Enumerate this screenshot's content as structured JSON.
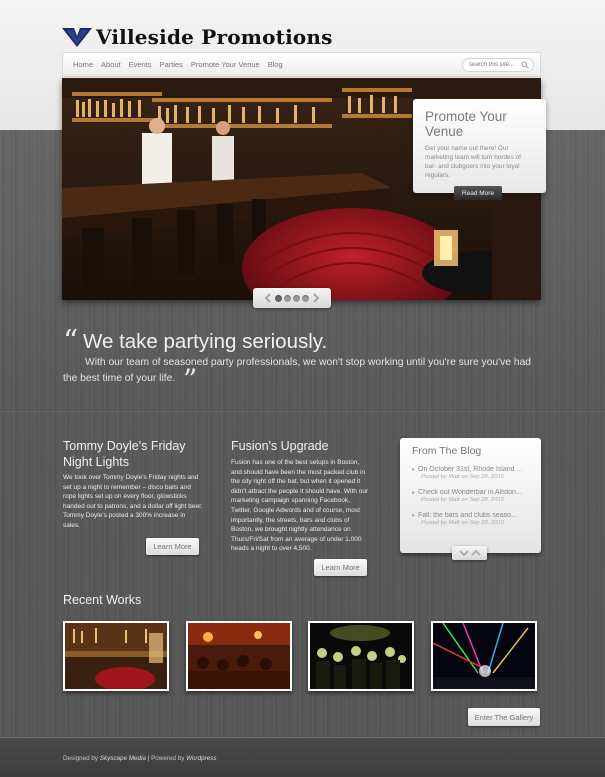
{
  "header": {
    "site_title": "Villeside Promotions",
    "nav": [
      "Home",
      "About",
      "Events",
      "Parties",
      "Promote Your Venue",
      "Blog"
    ],
    "search_placeholder": "search this site..."
  },
  "slider": {
    "promo_title": "Promote Your Venue",
    "promo_text": "Get your name out there! Our marketing team will turn hordes of bar- and clubgoers into your loyal regulars.",
    "promo_button": "Read More",
    "slide_count": 4,
    "active_slide": 1
  },
  "tagline": {
    "open_quote": "“",
    "heading": "We take partying seriously.",
    "text": "With our team of seasoned party professionals, we won't stop working until you're sure you've had the best time of your life.",
    "close_quote": "”"
  },
  "columns": [
    {
      "title": "Tommy Doyle's Friday Night Lights",
      "text": "We took over Tommy Doyle's Friday nights and set up a night to remember – disco balls and rope lights set up on every floor, glowsticks handed out to patrons, and a dollar off light beer. Tommy Doyle's posted a 300% increase in sales.",
      "button": "Learn More"
    },
    {
      "title": "Fusion's Upgrade",
      "text": "Fusion has one of the best setups in Boston, and should have been the most packed club in the city right off the bat, but when it opened it didn't attract the people it should have. With our marketing campaign spanning Facebook, Twitter, Google Adwords and of course, most importantly, the streets, bars and clubs of Boston, we brought nightly attendance on Thurs/Fri/Sat from an average of under 1,000 heads a night to over 4,500.",
      "button": "Learn More"
    }
  ],
  "blog": {
    "title": "From The Blog",
    "items": [
      {
        "title": "On October 31st, Rhode Island ...",
        "meta": "Posted by Matt on Sep 28, 2010"
      },
      {
        "title": "Check out Wonderbar in Allston...",
        "meta": "Posted by Matt on Sep 28, 2010"
      },
      {
        "title": "Fall: the bars and clubs seaso...",
        "meta": "Posted by Matt on Sep 28, 2010"
      }
    ]
  },
  "works": {
    "title": "Recent Works",
    "items": [
      "bar-interior-photo",
      "restaurant-crowd-photo",
      "nightclub-crowd-photo",
      "laser-party-photo"
    ],
    "gallery_button": "Enter The Gallery"
  },
  "footer": {
    "designed_by_prefix": "Designed by ",
    "designer": "Skyscape Media",
    "separator": " | Powered by ",
    "platform": "Wordpress"
  },
  "colors": {
    "wood": "#5f5f5f",
    "header_bg": "#eeeeee",
    "accent_red": "#8b1a1a",
    "logo_navy": "#1c2a6b"
  }
}
